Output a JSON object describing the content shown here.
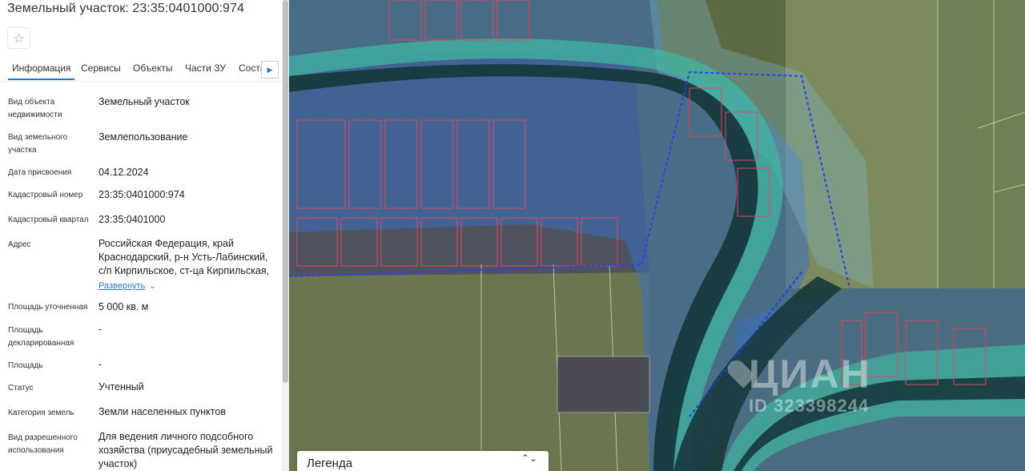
{
  "header": {
    "title": "Земельный участок: 23:35:0401000:974"
  },
  "favorite": {
    "icon": "star-icon",
    "glyph": "☆"
  },
  "tabs": [
    {
      "label": "Информация",
      "active": true
    },
    {
      "label": "Сервисы"
    },
    {
      "label": "Объекты"
    },
    {
      "label": "Части ЗУ"
    },
    {
      "label": "Состав"
    }
  ],
  "tab_next_glyph": "▶",
  "fields": {
    "object_type": {
      "label": "Вид объекта недвижимости",
      "value": "Земельный участок"
    },
    "land_type": {
      "label": "Вид земельного участка",
      "value": "Землепользование"
    },
    "assign_date": {
      "label": "Дата присвоения",
      "value": "04.12.2024"
    },
    "cad_number": {
      "label": "Кадастровый номер",
      "value": "23:35:0401000:974"
    },
    "cad_quarter": {
      "label": "Кадастровый квартал",
      "value": "23:35:0401000"
    },
    "address": {
      "label": "Адрес",
      "value": "Российская Федерация, край Краснодарский, р-н Усть-Лабинский, с/п Кирпильское, ст-ца Кирпильская,",
      "expand": "Развернуть",
      "expand_glyph": "⌄"
    },
    "area_precise": {
      "label": "Площадь уточненная",
      "value": "5 000 кв. м"
    },
    "area_declared": {
      "label": "Площадь декларированная",
      "value": "-"
    },
    "area": {
      "label": "Площадь",
      "value": "-"
    },
    "status": {
      "label": "Статус",
      "value": "Учтенный"
    },
    "land_category": {
      "label": "Категория земель",
      "value": "Земли населенных пунктов"
    },
    "permitted_use": {
      "label": "Вид разрешенного использования",
      "value": "Для ведения личного подсобного хозяйства (приусадебный земельный участок)"
    }
  },
  "map": {
    "watermark_brand": "ЦИАН",
    "watermark_id": "ID 323398244",
    "legend_title": "Легенда",
    "legend_arrows": "⌃⌄"
  },
  "colors": {
    "accent": "#2a76d2",
    "zone_blue": "#3a6fc0",
    "zone_teal": "#3fb6a0",
    "parcel_outline": "#e0485a",
    "boundary_dashed": "#1d3fd6"
  }
}
